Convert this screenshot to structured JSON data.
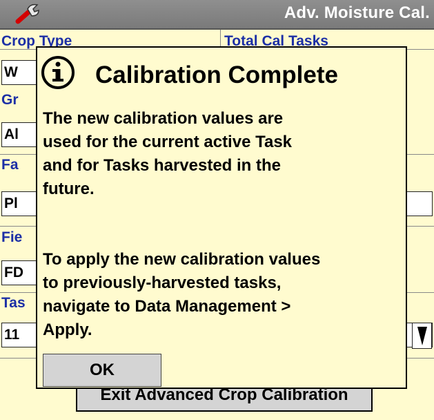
{
  "header": {
    "title": "Adv. Moisture Cal.",
    "icon": "wrench-icon"
  },
  "form": {
    "crop_type_label": "Crop Type",
    "total_cal_tasks_label": "Total Cal Tasks",
    "crop_type_value": "W",
    "grower_label": "Gr",
    "grower_value": "Al",
    "farm_label": "Fa",
    "farm_value": "Pl",
    "field_label": "Fie",
    "field_value": "FD",
    "task_label": "Tas",
    "task_value": "11"
  },
  "exit_button_label": "Exit Advanced Crop Calibration",
  "dialog": {
    "icon": "info-icon",
    "title": "Calibration Complete",
    "lines": [
      "The new calibration values are",
      "used for the current active Task",
      "and for Tasks harvested in the",
      "future.",
      "",
      "To apply the new calibration values",
      "to previously-harvested tasks,",
      "navigate to Data Management >",
      "Apply."
    ],
    "ok_label": "OK"
  }
}
